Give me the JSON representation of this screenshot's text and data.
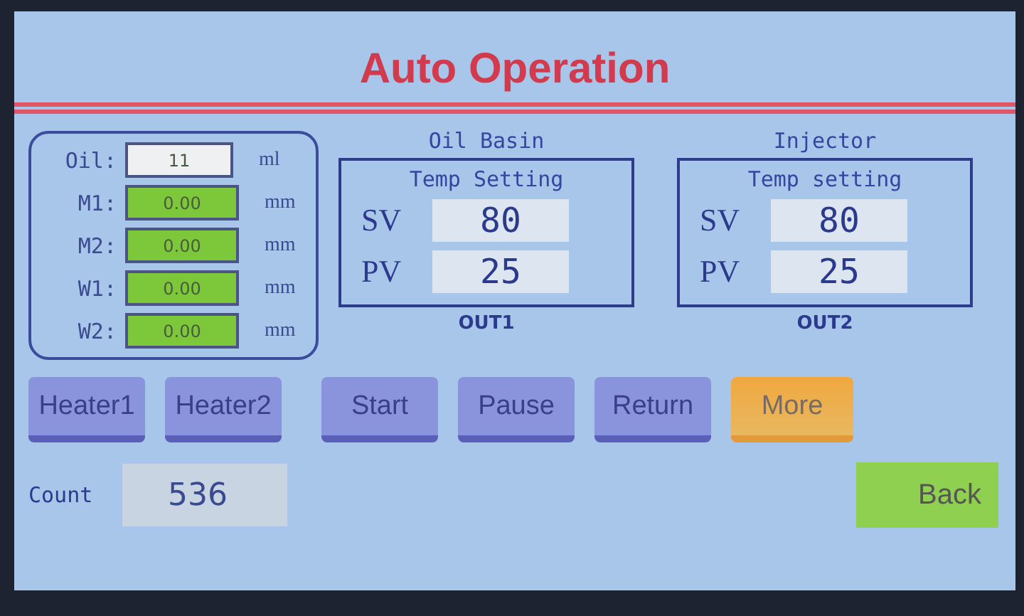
{
  "title": "Auto Operation",
  "readings": [
    {
      "label": "Oil:",
      "value": "11",
      "unit": "ml",
      "kind": "input"
    },
    {
      "label": "M1:",
      "value": "0.00",
      "unit": "mm",
      "kind": "measure"
    },
    {
      "label": "M2:",
      "value": "0.00",
      "unit": "mm",
      "kind": "measure"
    },
    {
      "label": "W1:",
      "value": "0.00",
      "unit": "mm",
      "kind": "measure"
    },
    {
      "label": "W2:",
      "value": "0.00",
      "unit": "mm",
      "kind": "measure"
    }
  ],
  "temp_panels": [
    {
      "heading": [
        "Oil Basin",
        "Temp Setting"
      ],
      "sv_label": "SV",
      "sv": "80",
      "pv_label": "PV",
      "pv": "25",
      "output": "OUT1"
    },
    {
      "heading": [
        "Injector",
        "Temp setting"
      ],
      "pv_label": "PV",
      "sv_label": "SV",
      "sv": "80",
      "pv": "25",
      "output": "OUT2"
    }
  ],
  "buttons": [
    {
      "label": "Heater1",
      "kind": "normal"
    },
    {
      "label": "Heater2",
      "kind": "normal"
    },
    {
      "label": "Start",
      "kind": "normal"
    },
    {
      "label": "Pause",
      "kind": "normal"
    },
    {
      "label": "Return",
      "kind": "normal"
    },
    {
      "label": "More",
      "kind": "highlight"
    }
  ],
  "count": {
    "label": "Count",
    "value": "536"
  },
  "back_button": {
    "label": "Back"
  }
}
